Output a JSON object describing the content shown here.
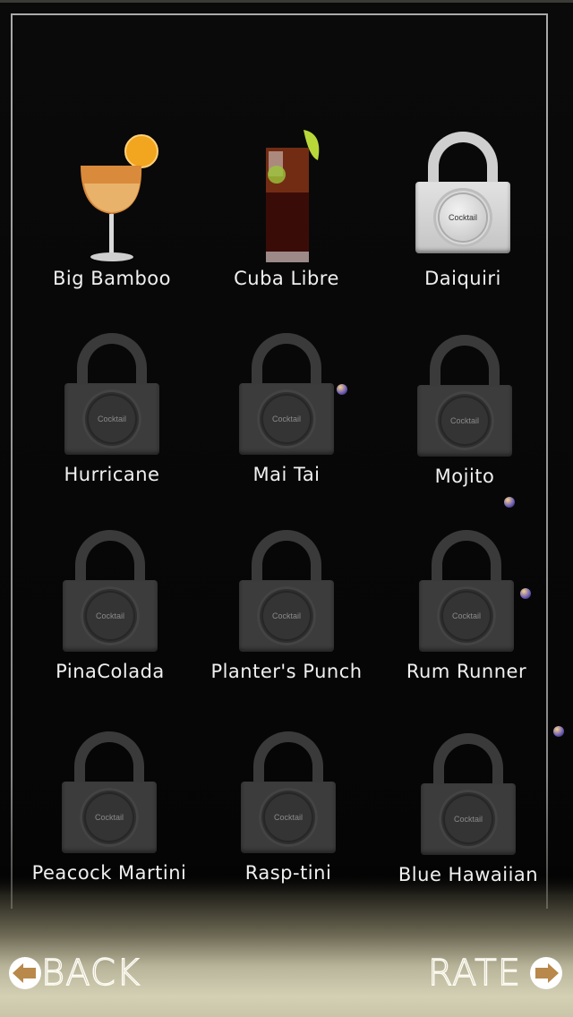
{
  "grid": {
    "items": [
      {
        "name": "Big Bamboo",
        "status": "unlocked",
        "image": "big-bamboo-glass"
      },
      {
        "name": "Cuba Libre",
        "status": "unlocked",
        "image": "cuba-libre-glass"
      },
      {
        "name": "Daiquiri",
        "status": "next-unlock",
        "lock_text": "Cocktail"
      },
      {
        "name": "Hurricane",
        "status": "locked",
        "lock_text": "Cocktail"
      },
      {
        "name": "Mai Tai",
        "status": "locked",
        "lock_text": "Cocktail"
      },
      {
        "name": "Mojito",
        "status": "locked",
        "lock_text": "Cocktail"
      },
      {
        "name": "PinaColada",
        "status": "locked",
        "lock_text": "Cocktail"
      },
      {
        "name": "Planter's Punch",
        "status": "locked",
        "lock_text": "Cocktail"
      },
      {
        "name": "Rum Runner",
        "status": "locked",
        "lock_text": "Cocktail"
      },
      {
        "name": "Peacock Martini",
        "status": "locked",
        "lock_text": "Cocktail"
      },
      {
        "name": "Rasp-tini",
        "status": "locked",
        "lock_text": "Cocktail"
      },
      {
        "name": "Blue Hawaiian",
        "status": "locked",
        "lock_text": "Cocktail"
      }
    ]
  },
  "footer": {
    "back_label": "BACK",
    "rate_label": "RATE"
  },
  "colors": {
    "arrow_gold": "#b8894a",
    "label": "#f0f0f0"
  }
}
